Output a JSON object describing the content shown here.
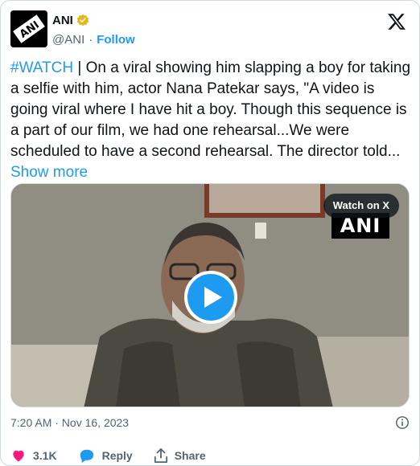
{
  "author": {
    "display_name": "ANI",
    "handle": "@ANI",
    "separator": "·",
    "follow_label": "Follow",
    "avatar_text": "ANI"
  },
  "tweet": {
    "hashtag": "#WATCH",
    "body": " | On a viral showing him slapping a boy for taking a selfie with him, actor Nana Patekar says, \"A video is going viral where I have hit a boy. Though this sequence is a part of our film, we had one rehearsal...We were scheduled to have a second rehearsal. The director told...",
    "show_more": "Show more"
  },
  "media": {
    "watch_label": "Watch on X",
    "watermark": "ANI"
  },
  "meta": {
    "timestamp": "7:20 AM · Nov 16, 2023"
  },
  "actions": {
    "like_count": "3.1K",
    "reply_label": "Reply",
    "share_label": "Share"
  },
  "colors": {
    "accent": "#1d9bf0",
    "like": "#f91880",
    "verified": "#e2b719"
  },
  "icons": [
    "verified-badge-icon",
    "x-logo-icon",
    "play-icon",
    "info-icon",
    "heart-icon",
    "reply-icon",
    "share-icon"
  ]
}
